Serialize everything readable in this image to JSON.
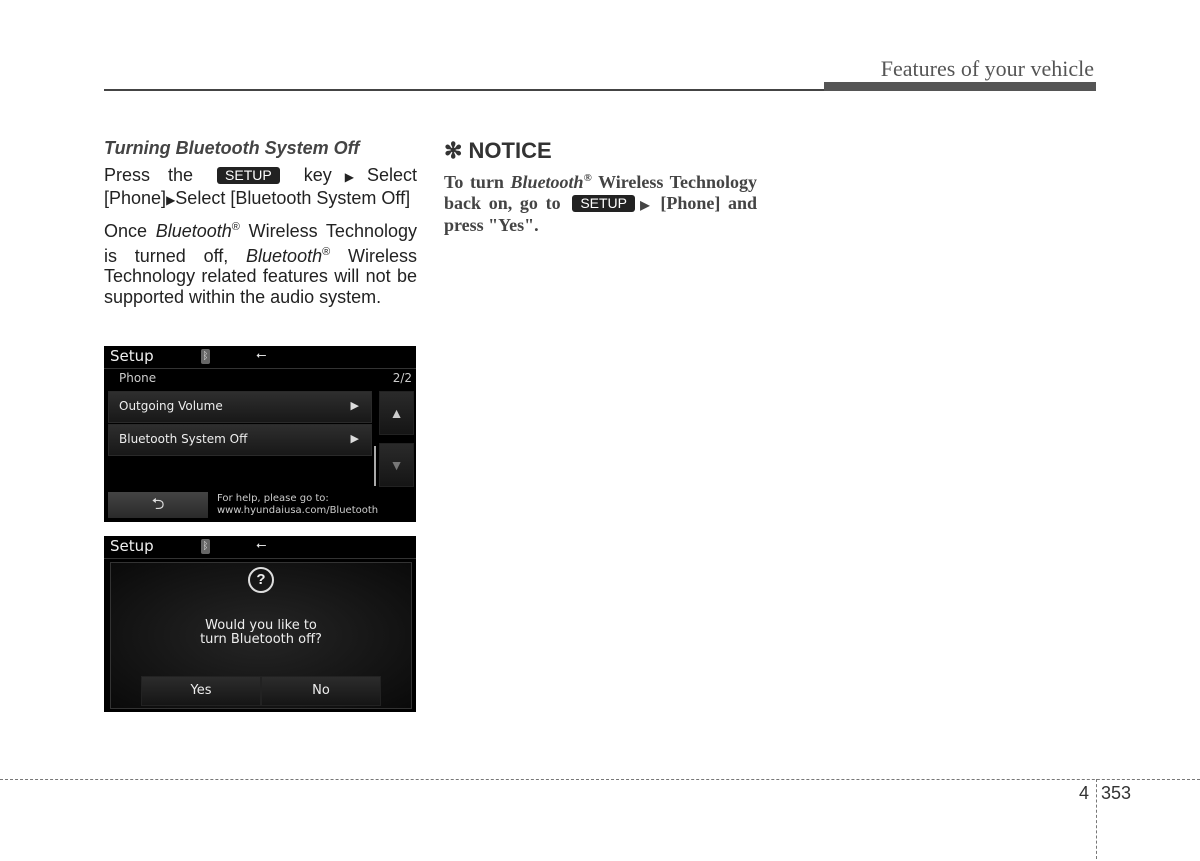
{
  "header": {
    "title": "Features of your vehicle"
  },
  "left": {
    "section_title": "Turning Bluetooth System Off",
    "step": {
      "press_the": "Press the",
      "key_label": "SETUP",
      "key_select": "key",
      "select1": "Select",
      "phone": "[Phone]",
      "select2": "Select [Bluetooth System Off]"
    },
    "para2": {
      "once": "Once",
      "bluetooth": "Bluetooth",
      "reg": "®",
      "wireless_tech": "Wireless Technology is turned off,",
      "rest": "Wireless Technology related features will not be supported within the audio system."
    }
  },
  "screen1": {
    "title": "Setup",
    "bt_icon": "bluetooth-icon",
    "usb_icon": "usb-icon",
    "subtitle": "Phone",
    "page": "2/2",
    "items": [
      {
        "label": "Outgoing Volume"
      },
      {
        "label": "Bluetooth System Off"
      }
    ],
    "help_line1": "For help, please go to:",
    "help_line2": "www.hyundaiusa.com/Bluetooth"
  },
  "screen2": {
    "title": "Setup",
    "message_line1": "Would you like to",
    "message_line2": "turn Bluetooth off?",
    "yes_label": "Yes",
    "no_label": "No"
  },
  "notice": {
    "title": "✻ NOTICE",
    "to_turn": "To turn",
    "bluetooth": "Bluetooth",
    "reg": "®",
    "wireless": "Wireless Technology back on, go to",
    "key_label": "SETUP",
    "rest": "[Phone] and press \"Yes\"."
  },
  "footer": {
    "chapter": "4",
    "page": "353"
  }
}
